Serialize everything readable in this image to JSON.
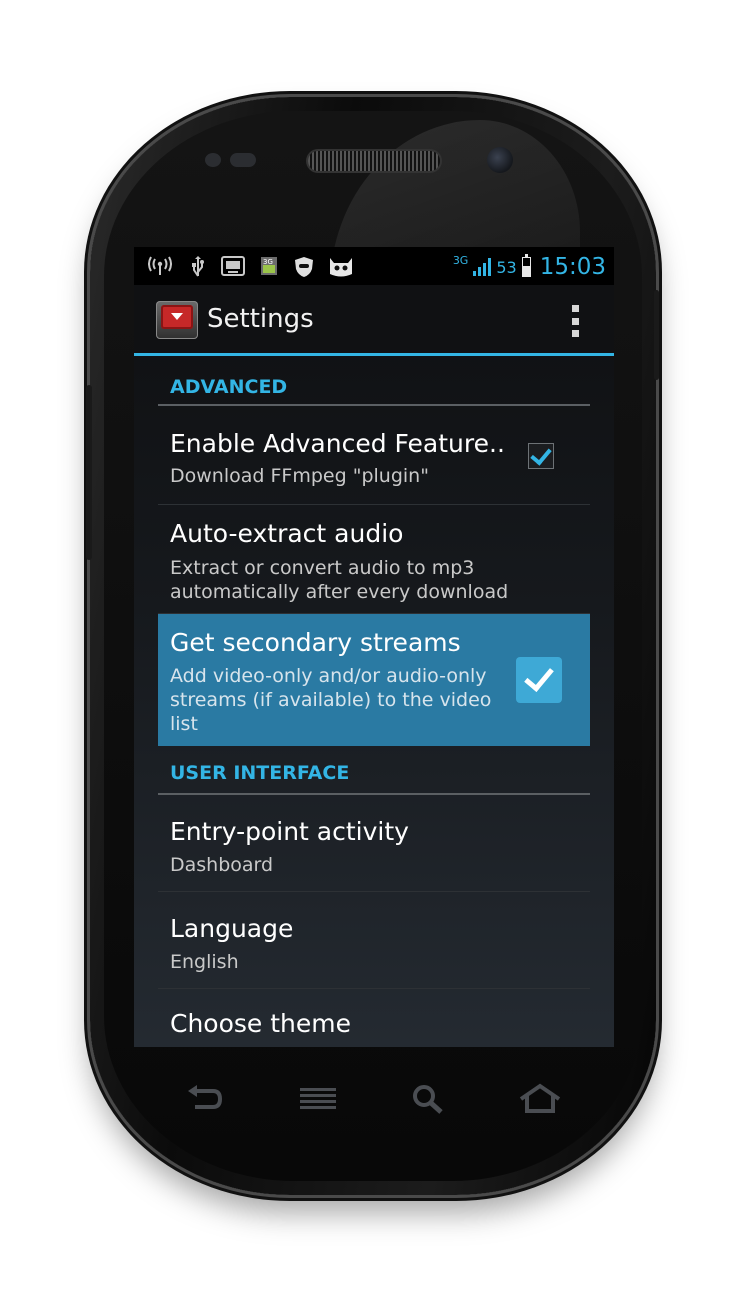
{
  "status_bar": {
    "network_type": "3G",
    "battery_level": "53",
    "time": "15:03",
    "left_icons": [
      "wireless-icon",
      "usb-icon",
      "screen-icon",
      "sim-3g-icon",
      "shield-icon",
      "cyanogen-icon"
    ]
  },
  "action_bar": {
    "title": "Settings",
    "app_icon": "app-logo-icon",
    "overflow_icon": "overflow-menu-icon"
  },
  "sections": [
    {
      "header": "ADVANCED",
      "items": [
        {
          "title": "Enable Advanced Feature..",
          "summary": "Download FFmpeg \"plugin\"",
          "checked": true
        },
        {
          "title": "Auto-extract audio",
          "summary": "Extract or convert audio to mp3 automatically after every download"
        },
        {
          "title": "Get secondary streams",
          "summary": "Add video-only and/or audio-only streams (if available) to the video list",
          "checked": true,
          "selected": true
        }
      ]
    },
    {
      "header": "USER INTERFACE",
      "items": [
        {
          "title": "Entry-point activity",
          "summary": "Dashboard"
        },
        {
          "title": "Language",
          "summary": "English"
        },
        {
          "title": "Choose theme"
        }
      ]
    }
  ],
  "nav_keys": [
    "back-icon",
    "menu-icon",
    "search-icon",
    "home-icon"
  ],
  "colors": {
    "accent": "#33b5e5",
    "selected_row": "#2a7aa3",
    "status_bar": "#000000"
  }
}
